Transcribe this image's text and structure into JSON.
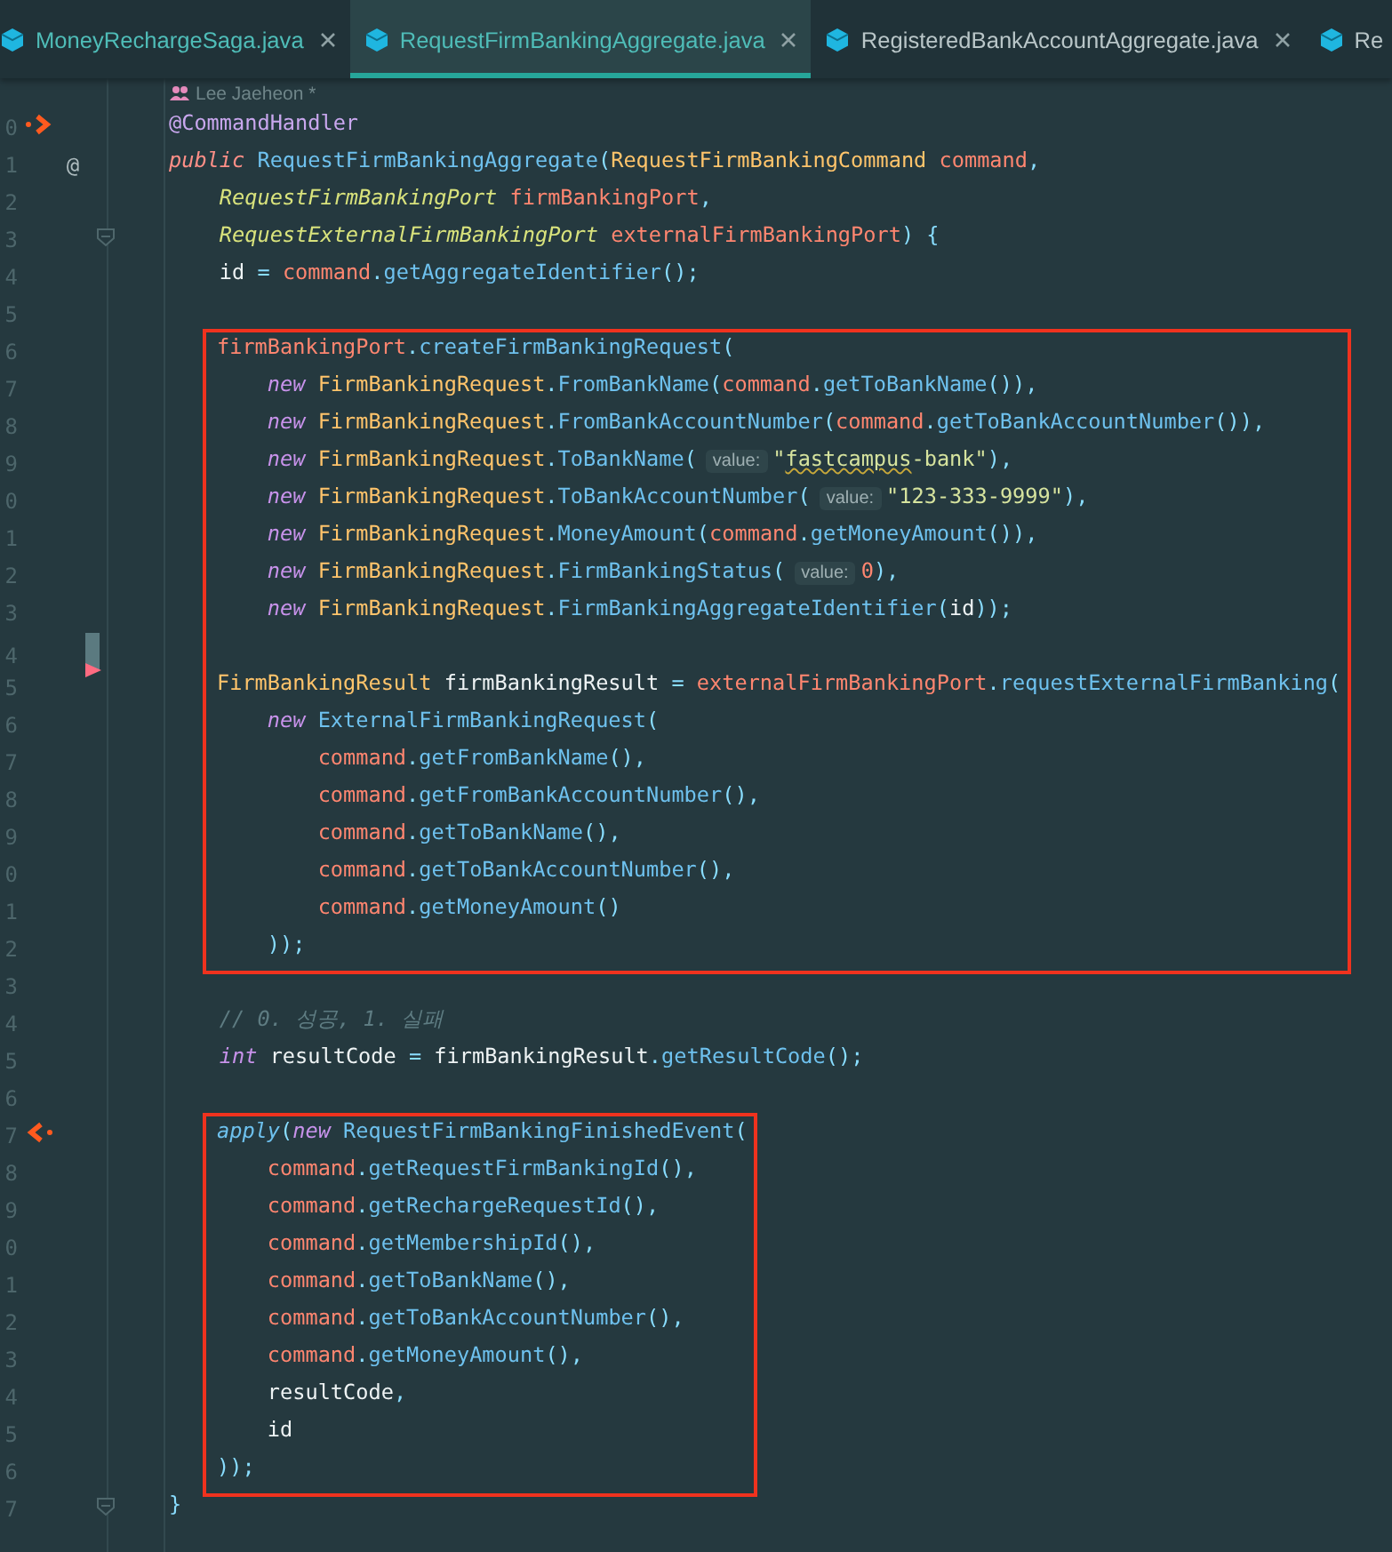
{
  "tabs": [
    {
      "label": "MoneyRechargeSaga.java",
      "selected": false,
      "closable": true,
      "color": "#4fbdb8"
    },
    {
      "label": "RequestFirmBankingAggregate.java",
      "selected": true,
      "closable": true,
      "color": "#4fbdb8"
    },
    {
      "label": "RegisteredBankAccountAggregate.java",
      "selected": false,
      "closable": true,
      "color": "#b9c6c8"
    },
    {
      "label": "Re",
      "selected": false,
      "closable": false,
      "color": "#b9c6c8"
    }
  ],
  "author_hint": "Lee Jaeheon *",
  "code_blocks": [
    {
      "kind": "plain",
      "lines": [
        {
          "number": "0",
          "marker": {
            "kind": "handler-out"
          },
          "tokens": [
            {
              "kind": "a",
              "text": "@CommandHandler"
            }
          ]
        },
        {
          "number": "1",
          "marker": {
            "kind": "annotation",
            "symbol": "@"
          },
          "tokens": [
            {
              "kind": "mod",
              "text": "public "
            },
            {
              "kind": "fn",
              "text": "RequestFirmBankingAggregate"
            },
            {
              "kind": "p",
              "text": "("
            },
            {
              "kind": "type",
              "text": "RequestFirmBankingCommand "
            },
            {
              "kind": "var",
              "text": "command"
            },
            {
              "kind": "p",
              "text": ","
            }
          ]
        },
        {
          "number": "2",
          "tokens": [
            {
              "kind": "itype",
              "text": "    RequestFirmBankingPort "
            },
            {
              "kind": "var",
              "text": "firmBankingPort"
            },
            {
              "kind": "p",
              "text": ","
            }
          ]
        },
        {
          "number": "3",
          "marker": {
            "kind": "fold"
          },
          "tokens": [
            {
              "kind": "itype",
              "text": "    RequestExternalFirmBankingPort "
            },
            {
              "kind": "var",
              "text": "externalFirmBankingPort"
            },
            {
              "kind": "p",
              "text": ") {"
            }
          ]
        },
        {
          "number": "4",
          "tokens": [
            {
              "kind": "id",
              "text": "    id"
            },
            {
              "kind": "p",
              "text": " = "
            },
            {
              "kind": "var",
              "text": "command"
            },
            {
              "kind": "p",
              "text": "."
            },
            {
              "kind": "fn",
              "text": "getAggregateIdentifier"
            },
            {
              "kind": "p",
              "text": "();"
            }
          ]
        },
        {
          "number": "5"
        }
      ]
    },
    {
      "kind": "highlight",
      "lines": [
        {
          "number": "6",
          "tokens": [
            {
              "kind": "var",
              "text": "firmBankingPort"
            },
            {
              "kind": "p",
              "text": "."
            },
            {
              "kind": "fn",
              "text": "createFirmBankingRequest"
            },
            {
              "kind": "p",
              "text": "("
            }
          ]
        },
        {
          "number": "7",
          "tokens": [
            {
              "kind": "kw",
              "text": "    new "
            },
            {
              "kind": "type",
              "text": "FirmBankingRequest"
            },
            {
              "kind": "p",
              "text": "."
            },
            {
              "kind": "fn",
              "text": "FromBankName"
            },
            {
              "kind": "p",
              "text": "("
            },
            {
              "kind": "var",
              "text": "command"
            },
            {
              "kind": "p",
              "text": "."
            },
            {
              "kind": "fn",
              "text": "getToBankName"
            },
            {
              "kind": "p",
              "text": "()),"
            }
          ]
        },
        {
          "number": "8",
          "tokens": [
            {
              "kind": "kw",
              "text": "    new "
            },
            {
              "kind": "type",
              "text": "FirmBankingRequest"
            },
            {
              "kind": "p",
              "text": "."
            },
            {
              "kind": "fn",
              "text": "FromBankAccountNumber"
            },
            {
              "kind": "p",
              "text": "("
            },
            {
              "kind": "var",
              "text": "command"
            },
            {
              "kind": "p",
              "text": "."
            },
            {
              "kind": "fn",
              "text": "getToBankAccountNumber"
            },
            {
              "kind": "p",
              "text": "()),"
            }
          ]
        },
        {
          "number": "9",
          "tokens": [
            {
              "kind": "kw",
              "text": "    new "
            },
            {
              "kind": "type",
              "text": "FirmBankingRequest"
            },
            {
              "kind": "p",
              "text": "."
            },
            {
              "kind": "fn",
              "text": "ToBankName"
            },
            {
              "kind": "p",
              "text": "("
            },
            {
              "kind": "hint",
              "text": "value:"
            },
            {
              "kind": "str",
              "text": "\""
            },
            {
              "kind": "strw",
              "text": "fastcampus"
            },
            {
              "kind": "str",
              "text": "-bank\""
            },
            {
              "kind": "p",
              "text": "),"
            }
          ]
        },
        {
          "number": "0",
          "tokens": [
            {
              "kind": "kw",
              "text": "    new "
            },
            {
              "kind": "type",
              "text": "FirmBankingRequest"
            },
            {
              "kind": "p",
              "text": "."
            },
            {
              "kind": "fn",
              "text": "ToBankAccountNumber"
            },
            {
              "kind": "p",
              "text": "("
            },
            {
              "kind": "hint",
              "text": "value:"
            },
            {
              "kind": "str",
              "text": "\"123-333-9999\""
            },
            {
              "kind": "p",
              "text": "),"
            }
          ]
        },
        {
          "number": "1",
          "tokens": [
            {
              "kind": "kw",
              "text": "    new "
            },
            {
              "kind": "type",
              "text": "FirmBankingRequest"
            },
            {
              "kind": "p",
              "text": "."
            },
            {
              "kind": "fn",
              "text": "MoneyAmount"
            },
            {
              "kind": "p",
              "text": "("
            },
            {
              "kind": "var",
              "text": "command"
            },
            {
              "kind": "p",
              "text": "."
            },
            {
              "kind": "fn",
              "text": "getMoneyAmount"
            },
            {
              "kind": "p",
              "text": "()),"
            }
          ]
        },
        {
          "number": "2",
          "tokens": [
            {
              "kind": "kw",
              "text": "    new "
            },
            {
              "kind": "type",
              "text": "FirmBankingRequest"
            },
            {
              "kind": "p",
              "text": "."
            },
            {
              "kind": "fn",
              "text": "FirmBankingStatus"
            },
            {
              "kind": "p",
              "text": "("
            },
            {
              "kind": "hint",
              "text": "value:"
            },
            {
              "kind": "num",
              "text": "0"
            },
            {
              "kind": "p",
              "text": "),"
            }
          ]
        },
        {
          "number": "3",
          "tokens": [
            {
              "kind": "kw",
              "text": "    new "
            },
            {
              "kind": "type",
              "text": "FirmBankingRequest"
            },
            {
              "kind": "p",
              "text": "."
            },
            {
              "kind": "fn",
              "text": "FirmBankingAggregateIdentifier"
            },
            {
              "kind": "p",
              "text": "("
            },
            {
              "kind": "id",
              "text": "id"
            },
            {
              "kind": "p",
              "text": "));"
            }
          ]
        },
        {
          "number": "4",
          "marker": {
            "kind": "changed"
          }
        },
        {
          "number": "5",
          "marker": {
            "kind": "warning"
          },
          "tokens": [
            {
              "kind": "type",
              "text": "FirmBankingResult "
            },
            {
              "kind": "id",
              "text": "firmBankingResult"
            },
            {
              "kind": "p",
              "text": " = "
            },
            {
              "kind": "var",
              "text": "externalFirmBankingPort"
            },
            {
              "kind": "p",
              "text": "."
            },
            {
              "kind": "fn",
              "text": "requestExternalFirmBanking"
            },
            {
              "kind": "p",
              "text": "("
            }
          ]
        },
        {
          "number": "6",
          "tokens": [
            {
              "kind": "kw",
              "text": "    new "
            },
            {
              "kind": "fn",
              "text": "ExternalFirmBankingRequest"
            },
            {
              "kind": "p",
              "text": "("
            }
          ]
        },
        {
          "number": "7",
          "tokens": [
            {
              "kind": "var",
              "text": "        command"
            },
            {
              "kind": "p",
              "text": "."
            },
            {
              "kind": "fn",
              "text": "getFromBankName"
            },
            {
              "kind": "p",
              "text": "(),"
            }
          ]
        },
        {
          "number": "8",
          "tokens": [
            {
              "kind": "var",
              "text": "        command"
            },
            {
              "kind": "p",
              "text": "."
            },
            {
              "kind": "fn",
              "text": "getFromBankAccountNumber"
            },
            {
              "kind": "p",
              "text": "(),"
            }
          ]
        },
        {
          "number": "9",
          "tokens": [
            {
              "kind": "var",
              "text": "        command"
            },
            {
              "kind": "p",
              "text": "."
            },
            {
              "kind": "fn",
              "text": "getToBankName"
            },
            {
              "kind": "p",
              "text": "(),"
            }
          ]
        },
        {
          "number": "0",
          "tokens": [
            {
              "kind": "var",
              "text": "        command"
            },
            {
              "kind": "p",
              "text": "."
            },
            {
              "kind": "fn",
              "text": "getToBankAccountNumber"
            },
            {
              "kind": "p",
              "text": "(),"
            }
          ]
        },
        {
          "number": "1",
          "tokens": [
            {
              "kind": "var",
              "text": "        command"
            },
            {
              "kind": "p",
              "text": "."
            },
            {
              "kind": "fn",
              "text": "getMoneyAmount"
            },
            {
              "kind": "p",
              "text": "()"
            }
          ]
        },
        {
          "number": "2",
          "tokens": [
            {
              "kind": "p",
              "text": "    ));"
            }
          ]
        }
      ]
    },
    {
      "kind": "plain",
      "lines": [
        {
          "number": "3"
        },
        {
          "number": "4",
          "tokens": [
            {
              "kind": "cm",
              "text": "    // 0. 성공, 1. 실패"
            }
          ]
        },
        {
          "number": "5",
          "tokens": [
            {
              "kind": "kw",
              "text": "    int "
            },
            {
              "kind": "id",
              "text": "resultCode"
            },
            {
              "kind": "p",
              "text": " = "
            },
            {
              "kind": "id",
              "text": "firmBankingResult"
            },
            {
              "kind": "p",
              "text": "."
            },
            {
              "kind": "fn",
              "text": "getResultCode"
            },
            {
              "kind": "p",
              "text": "();"
            }
          ]
        },
        {
          "number": "6"
        }
      ]
    },
    {
      "kind": "highlight",
      "lines": [
        {
          "number": "7",
          "marker": {
            "kind": "handler-in"
          },
          "tokens": [
            {
              "kind": "fni",
              "text": "apply"
            },
            {
              "kind": "p",
              "text": "("
            },
            {
              "kind": "kw",
              "text": "new "
            },
            {
              "kind": "fn",
              "text": "RequestFirmBankingFinishedEvent"
            },
            {
              "kind": "p",
              "text": "("
            }
          ]
        },
        {
          "number": "8",
          "tokens": [
            {
              "kind": "var",
              "text": "    command"
            },
            {
              "kind": "p",
              "text": "."
            },
            {
              "kind": "fn",
              "text": "getRequestFirmBankingId"
            },
            {
              "kind": "p",
              "text": "(),"
            }
          ]
        },
        {
          "number": "9",
          "tokens": [
            {
              "kind": "var",
              "text": "    command"
            },
            {
              "kind": "p",
              "text": "."
            },
            {
              "kind": "fn",
              "text": "getRechargeRequestId"
            },
            {
              "kind": "p",
              "text": "(),"
            }
          ]
        },
        {
          "number": "0",
          "tokens": [
            {
              "kind": "var",
              "text": "    command"
            },
            {
              "kind": "p",
              "text": "."
            },
            {
              "kind": "fn",
              "text": "getMembershipId"
            },
            {
              "kind": "p",
              "text": "(),"
            }
          ]
        },
        {
          "number": "1",
          "tokens": [
            {
              "kind": "var",
              "text": "    command"
            },
            {
              "kind": "p",
              "text": "."
            },
            {
              "kind": "fn",
              "text": "getToBankName"
            },
            {
              "kind": "p",
              "text": "(),"
            }
          ]
        },
        {
          "number": "2",
          "tokens": [
            {
              "kind": "var",
              "text": "    command"
            },
            {
              "kind": "p",
              "text": "."
            },
            {
              "kind": "fn",
              "text": "getToBankAccountNumber"
            },
            {
              "kind": "p",
              "text": "(),"
            }
          ]
        },
        {
          "number": "3",
          "tokens": [
            {
              "kind": "var",
              "text": "    command"
            },
            {
              "kind": "p",
              "text": "."
            },
            {
              "kind": "fn",
              "text": "getMoneyAmount"
            },
            {
              "kind": "p",
              "text": "(),"
            }
          ]
        },
        {
          "number": "4",
          "tokens": [
            {
              "kind": "id",
              "text": "    resultCode"
            },
            {
              "kind": "p",
              "text": ","
            }
          ]
        },
        {
          "number": "5",
          "tokens": [
            {
              "kind": "id",
              "text": "    id"
            }
          ]
        },
        {
          "number": "6",
          "tokens": [
            {
              "kind": "p",
              "text": "));"
            }
          ]
        }
      ]
    },
    {
      "kind": "plain",
      "lines": [
        {
          "number": "7",
          "marker": {
            "kind": "fold"
          },
          "tokens": [
            {
              "kind": "p",
              "text": "}"
            }
          ]
        }
      ]
    }
  ]
}
